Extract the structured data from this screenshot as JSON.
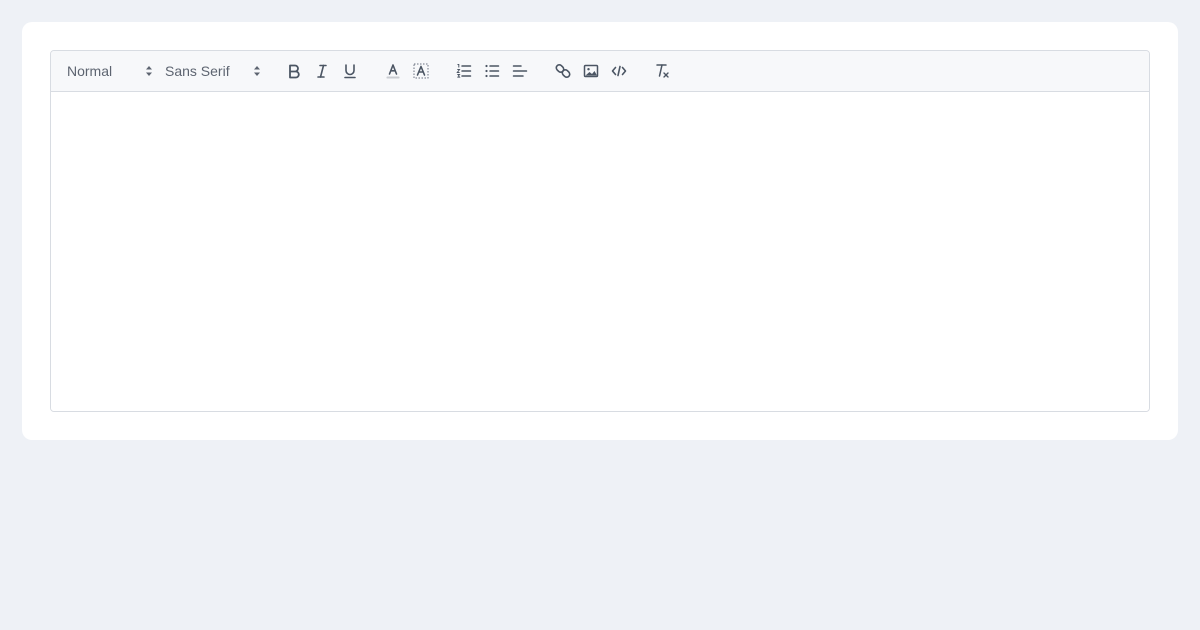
{
  "toolbar": {
    "header_select": {
      "selected": "Normal"
    },
    "font_select": {
      "selected": "Sans Serif"
    },
    "buttons": [
      {
        "name": "bold-icon"
      },
      {
        "name": "italic-icon"
      },
      {
        "name": "underline-icon"
      },
      {
        "name": "text-color-icon"
      },
      {
        "name": "background-color-icon"
      },
      {
        "name": "ordered-list-icon"
      },
      {
        "name": "bullet-list-icon"
      },
      {
        "name": "align-left-icon"
      },
      {
        "name": "link-icon"
      },
      {
        "name": "image-icon"
      },
      {
        "name": "code-icon"
      },
      {
        "name": "clear-format-icon"
      }
    ]
  },
  "editor": {
    "content": ""
  },
  "colors": {
    "page_bg": "#eef1f6",
    "card_bg": "#ffffff",
    "toolbar_bg": "#f7f8fa",
    "border": "#d8dce2",
    "icon": "#4b5563"
  }
}
